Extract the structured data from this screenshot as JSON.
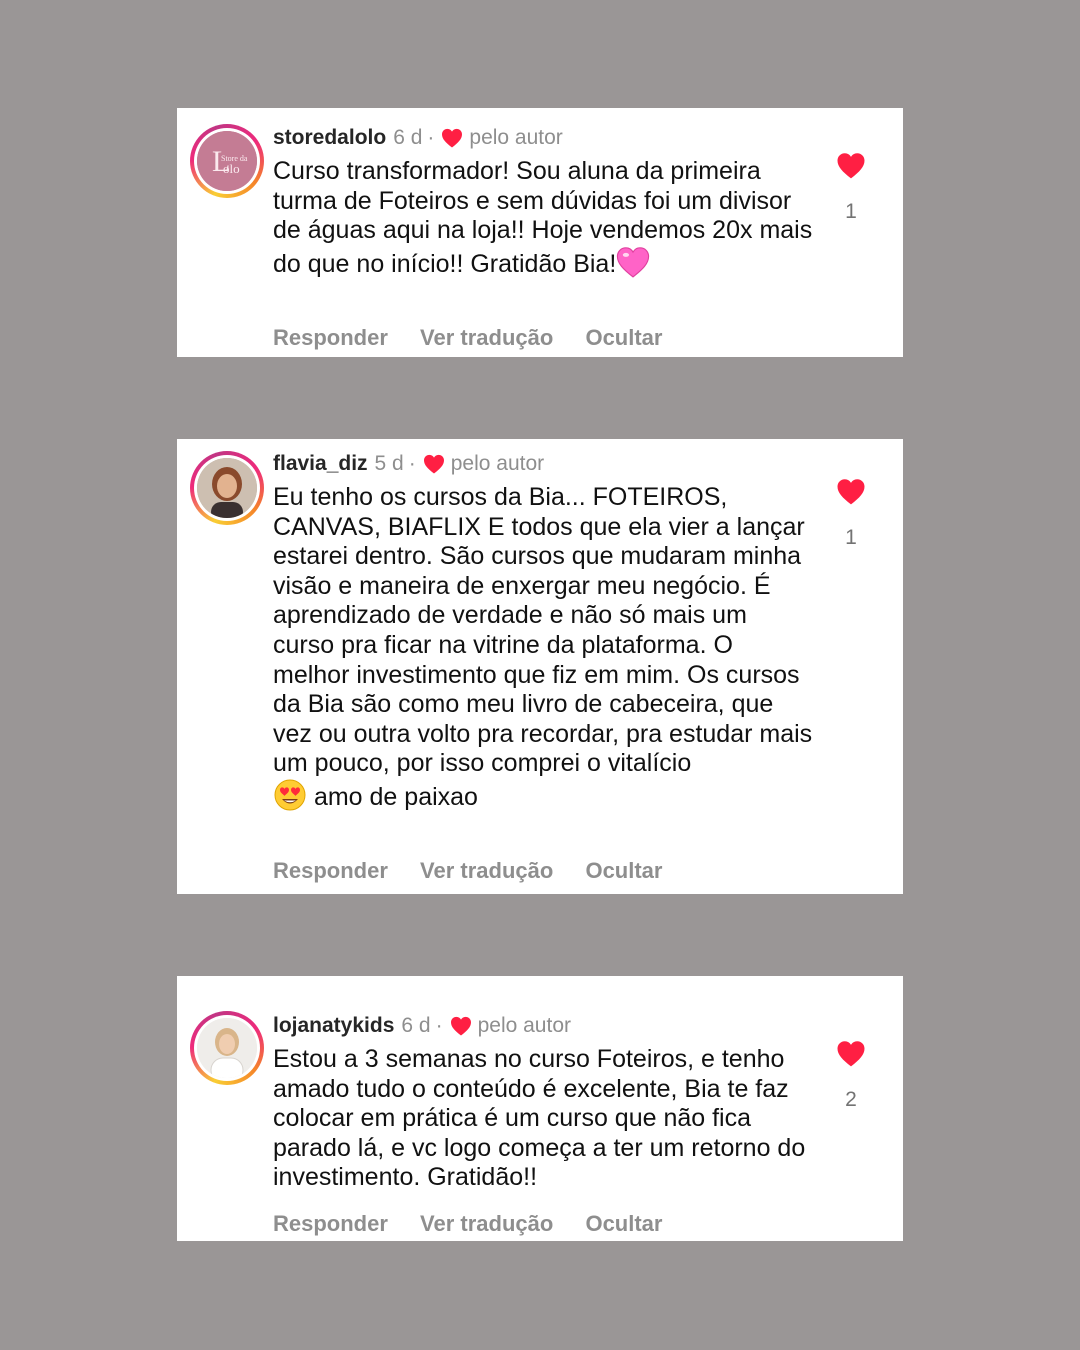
{
  "colors": {
    "background": "#9a9696",
    "heart": "#ff1f43",
    "emoji_pink": "#ff63c7"
  },
  "comments": [
    {
      "username": "storedalolo",
      "time": "6 d",
      "separator": "·",
      "author_like": "pelo autor",
      "text": "Curso transformador! Sou aluna da primeira turma de Foteiros e sem dúvidas foi um divisor de águas aqui na loja!! Hoje vendemos 20x mais do que no início!! Gratidão Bia!",
      "trailing_emoji": "pink-heart-icon",
      "like_count": "1",
      "avatar_text": "Store da Lolo",
      "actions": {
        "reply": "Responder",
        "translate": "Ver tradução",
        "hide": "Ocultar"
      }
    },
    {
      "username": "flavia_diz",
      "time": "5 d",
      "separator": "·",
      "author_like": "pelo autor",
      "text": "Eu tenho os cursos da Bia... FOTEIROS, CANVAS, BIAFLIX E todos que ela vier a lançar estarei dentro. São cursos que mudaram minha visão e maneira de enxergar meu negócio. É aprendizado de verdade e não só mais um curso pra ficar na vitrine da plataforma. O melhor investimento que fiz em mim. Os cursos da Bia são como meu livro de cabeceira, que vez ou outra volto pra recordar, pra estudar mais um pouco, por isso comprei o vitalício",
      "text_after_emoji": "amo de paixao",
      "emoji": "heart-eyes-emoji-icon",
      "like_count": "1",
      "actions": {
        "reply": "Responder",
        "translate": "Ver tradução",
        "hide": "Ocultar"
      }
    },
    {
      "username": "lojanatykids",
      "time": "6 d",
      "separator": "·",
      "author_like": "pelo autor",
      "text": "Estou a 3 semanas no curso Foteiros, e tenho amado tudo o conteúdo é excelente, Bia te faz colocar em prática é um curso que não fica parado lá, e vc logo começa a ter um retorno do investimento. Gratidão!!",
      "like_count": "2",
      "actions": {
        "reply": "Responder",
        "translate": "Ver tradução",
        "hide": "Ocultar"
      }
    }
  ]
}
